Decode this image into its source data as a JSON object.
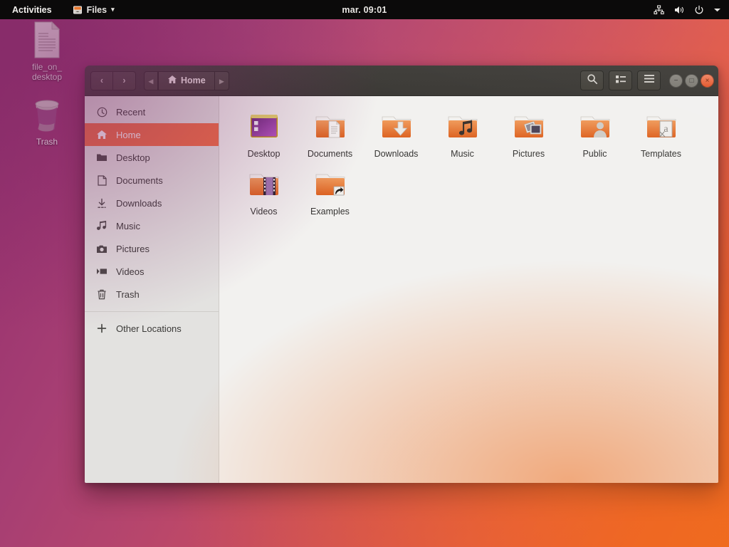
{
  "topbar": {
    "activities": "Activities",
    "app_menu": {
      "label": "Files",
      "icon": "files-app-icon",
      "arrow": "▾"
    },
    "clock": "mar. 09:01",
    "indicators": [
      {
        "name": "network-icon"
      },
      {
        "name": "volume-icon"
      },
      {
        "name": "power-icon"
      },
      {
        "name": "system-menu-arrow-icon"
      }
    ],
    "colors": {
      "background": "#0b0a0a",
      "text": "#e8e6e3"
    }
  },
  "desktop": {
    "wallpaper_colors": {
      "purple": "#8e2f6b",
      "orange": "#ef6a1e"
    },
    "icons": [
      {
        "name": "file_on_desktop",
        "label_line1": "file_on_",
        "label_line2": "desktop",
        "icon": "text-file-icon"
      },
      {
        "name": "trash",
        "label_line1": "Trash",
        "label_line2": "",
        "icon": "trash-icon"
      }
    ]
  },
  "window": {
    "headerbar": {
      "back_label": "‹",
      "forward_label": "›",
      "pathbar": {
        "prev_label": "◂",
        "crumb_label": "Home",
        "crumb_icon": "home-icon",
        "next_label": "▸"
      },
      "search_icon": "search-icon",
      "view_icon": "list-view-icon",
      "menu_icon": "hamburger-menu-icon",
      "window_buttons": {
        "minimize": "−",
        "maximize": "□",
        "close": "×"
      },
      "colors": {
        "background": "#3e3c38",
        "close_button": "#e4552a"
      }
    },
    "sidebar": {
      "items": [
        {
          "label": "Recent",
          "icon": "clock-icon",
          "selected": false
        },
        {
          "label": "Home",
          "icon": "home-icon",
          "selected": true
        },
        {
          "label": "Desktop",
          "icon": "folder-icon",
          "selected": false
        },
        {
          "label": "Documents",
          "icon": "document-icon",
          "selected": false
        },
        {
          "label": "Downloads",
          "icon": "download-icon",
          "selected": false
        },
        {
          "label": "Music",
          "icon": "music-icon",
          "selected": false
        },
        {
          "label": "Pictures",
          "icon": "camera-icon",
          "selected": false
        },
        {
          "label": "Videos",
          "icon": "video-icon",
          "selected": false
        },
        {
          "label": "Trash",
          "icon": "trash-icon",
          "selected": false
        }
      ],
      "other_locations": {
        "label": "Other Locations",
        "icon": "plus-icon"
      },
      "colors": {
        "background": "#e3e2e0",
        "selected": "#ef6d45"
      }
    },
    "content": {
      "files": [
        {
          "label": "Desktop",
          "icon": "folder-desktop-icon"
        },
        {
          "label": "Documents",
          "icon": "folder-documents-icon"
        },
        {
          "label": "Downloads",
          "icon": "folder-downloads-icon"
        },
        {
          "label": "Music",
          "icon": "folder-music-icon"
        },
        {
          "label": "Pictures",
          "icon": "folder-pictures-icon"
        },
        {
          "label": "Public",
          "icon": "folder-public-icon"
        },
        {
          "label": "Templates",
          "icon": "folder-templates-icon"
        },
        {
          "label": "Videos",
          "icon": "folder-videos-icon"
        },
        {
          "label": "Examples",
          "icon": "folder-symlink-icon"
        }
      ],
      "colors": {
        "background": "#f2f1ef",
        "folder": "#e8772e"
      }
    }
  }
}
